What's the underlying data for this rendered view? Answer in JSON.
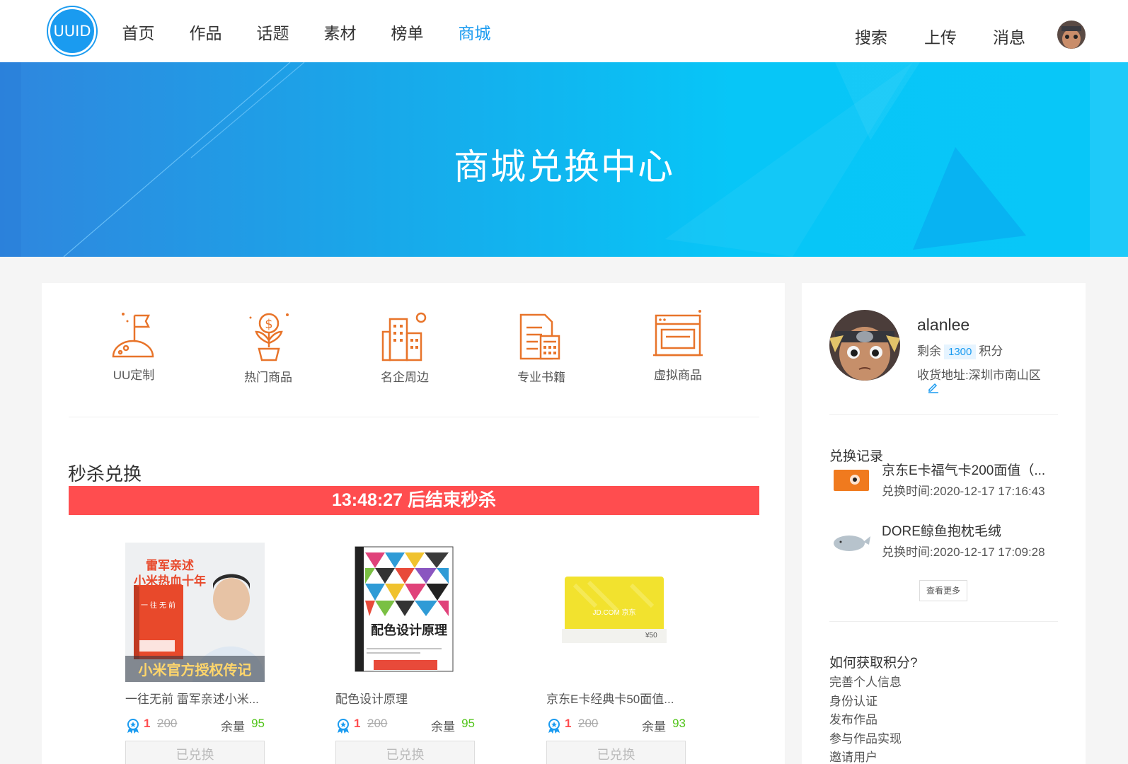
{
  "header": {
    "logo": "UUID",
    "nav": [
      "首页",
      "作品",
      "话题",
      "素材",
      "榜单",
      "商城"
    ],
    "active_index": 5,
    "search": "搜索",
    "upload": "上传",
    "messages": "消息"
  },
  "banner": {
    "title": "商城兑换中心"
  },
  "categories": [
    {
      "label": "UU定制",
      "icon": "flag-planet-icon"
    },
    {
      "label": "热门商品",
      "icon": "money-plant-icon"
    },
    {
      "label": "名企周边",
      "icon": "buildings-icon"
    },
    {
      "label": "专业书籍",
      "icon": "document-calculator-icon"
    },
    {
      "label": "虚拟商品",
      "icon": "browser-window-icon"
    }
  ],
  "flash": {
    "title": "秒杀兑换",
    "countdown": "13:48:27",
    "suffix": " 后结束秒杀"
  },
  "products": [
    {
      "name": "一往无前 雷军亲述小米...",
      "price": "1",
      "old_price": "200",
      "stock_label": "余量",
      "stock": "95",
      "button": "已兑换",
      "cover_lines": [
        "雷军亲述",
        "小米热血十年"
      ],
      "cover_tag": "一往无前",
      "cover_footer": "小米官方授权传记"
    },
    {
      "name": "配色设计原理",
      "price": "1",
      "old_price": "200",
      "stock_label": "余量",
      "stock": "95",
      "button": "已兑换",
      "cover_title": "配色设计原理"
    },
    {
      "name": "京东E卡经典卡50面值...",
      "price": "1",
      "old_price": "200",
      "stock_label": "余量",
      "stock": "93",
      "button": "已兑换",
      "card_brand": "JD.COM 京东",
      "card_value": "¥50"
    }
  ],
  "profile": {
    "username": "alanlee",
    "remain_label": "剩余",
    "points": "1300",
    "points_unit": "积分",
    "address_label": "收货地址:",
    "address": "深圳市南山区"
  },
  "records": {
    "title": "兑换记录",
    "items": [
      {
        "name": "京东E卡福气卡200面值（...",
        "time_label": "兑换时间:",
        "time": "2020-12-17 17:16:43"
      },
      {
        "name": "DORE鲸鱼抱枕毛绒",
        "time_label": "兑换时间:",
        "time": "2020-12-17 17:09:28"
      }
    ],
    "more": "查看更多"
  },
  "howto": {
    "title": "如何获取积分?",
    "items": [
      "完善个人信息",
      "身份认证",
      "发布作品",
      "参与作品实现",
      "邀请用户"
    ]
  },
  "colors": {
    "accent": "#1a9bf0",
    "flash": "#ff4d4f",
    "stock": "#52c41a",
    "icon_orange": "#e8742a"
  }
}
